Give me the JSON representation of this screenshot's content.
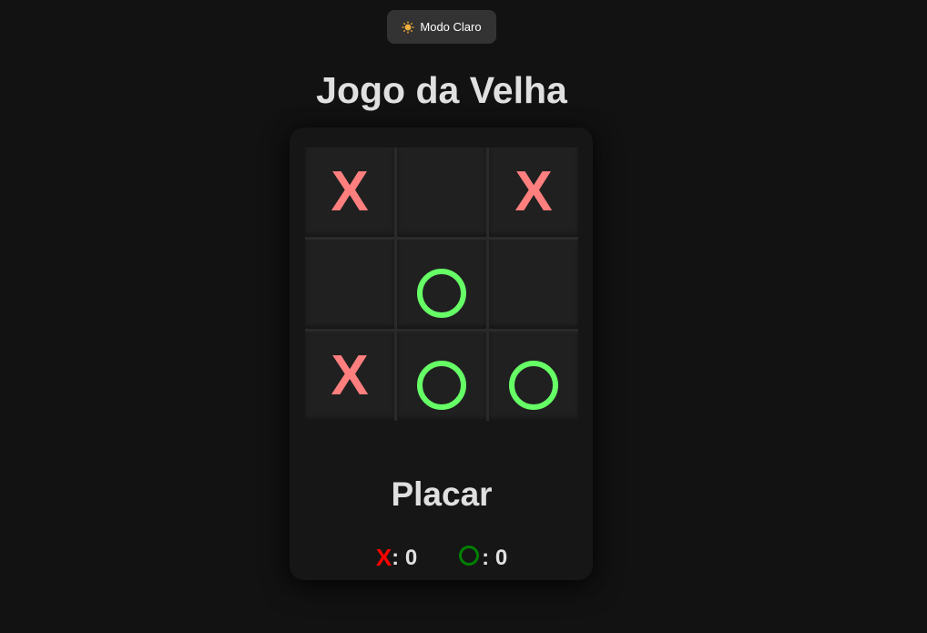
{
  "theme_toggle": {
    "icon": "sun-icon",
    "label": "Modo Claro"
  },
  "title": "Jogo da Velha",
  "board": {
    "cells": [
      "X",
      "",
      "X",
      "",
      "O",
      "",
      "X",
      "O",
      "O"
    ]
  },
  "scoreboard": {
    "title": "Placar",
    "x_symbol": "X",
    "x_score": ": 0",
    "o_score": ": 0"
  },
  "colors": {
    "background": "#121212",
    "x_mark": "#ff7f7f",
    "o_mark": "#66ff66",
    "score_x": "#ff0000",
    "score_o": "#008000"
  }
}
